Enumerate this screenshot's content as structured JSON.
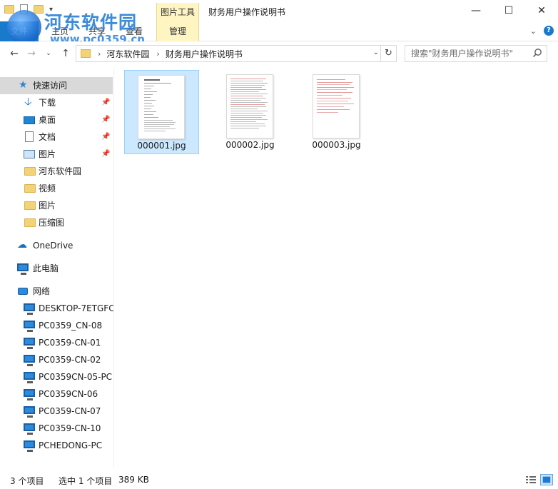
{
  "window": {
    "title": "财务用户操作说明书",
    "context_tab_group": "图片工具",
    "controls": {
      "minimize": "—",
      "maximize": "☐",
      "close": "✕"
    }
  },
  "watermark": {
    "title": "河东软件园",
    "url": "www.pc0359.cn"
  },
  "ribbon": {
    "file_tab": "文件",
    "tabs": [
      "主页",
      "共享",
      "查看"
    ],
    "context_tab": "管理",
    "help": "?"
  },
  "address": {
    "crumbs": [
      "河东软件园",
      "财务用户操作说明书"
    ],
    "search_placeholder": "搜索\"财务用户操作说明书\""
  },
  "nav": {
    "quick_access": "快速访问",
    "pinned": [
      {
        "label": "下载",
        "icon": "download-arrow-icon"
      },
      {
        "label": "桌面",
        "icon": "desktop-icon"
      },
      {
        "label": "文档",
        "icon": "document-icon"
      },
      {
        "label": "图片",
        "icon": "pictures-icon"
      }
    ],
    "folders": [
      "河东软件园",
      "视频",
      "图片",
      "压缩图"
    ],
    "onedrive": "OneDrive",
    "this_pc": "此电脑",
    "network": "网络",
    "computers": [
      "DESKTOP-7ETGFC",
      "PC0359_CN-08",
      "PC0359-CN-01",
      "PC0359-CN-02",
      "PC0359CN-05-PC",
      "PC0359CN-06",
      "PC0359-CN-07",
      "PC0359-CN-10",
      "PCHEDONG-PC"
    ]
  },
  "files": [
    {
      "name": "000001.jpg",
      "selected": true
    },
    {
      "name": "000002.jpg",
      "selected": false
    },
    {
      "name": "000003.jpg",
      "selected": false
    }
  ],
  "status": {
    "item_count": "3 个项目",
    "selection": "选中 1 个项目",
    "size": "389 KB"
  }
}
